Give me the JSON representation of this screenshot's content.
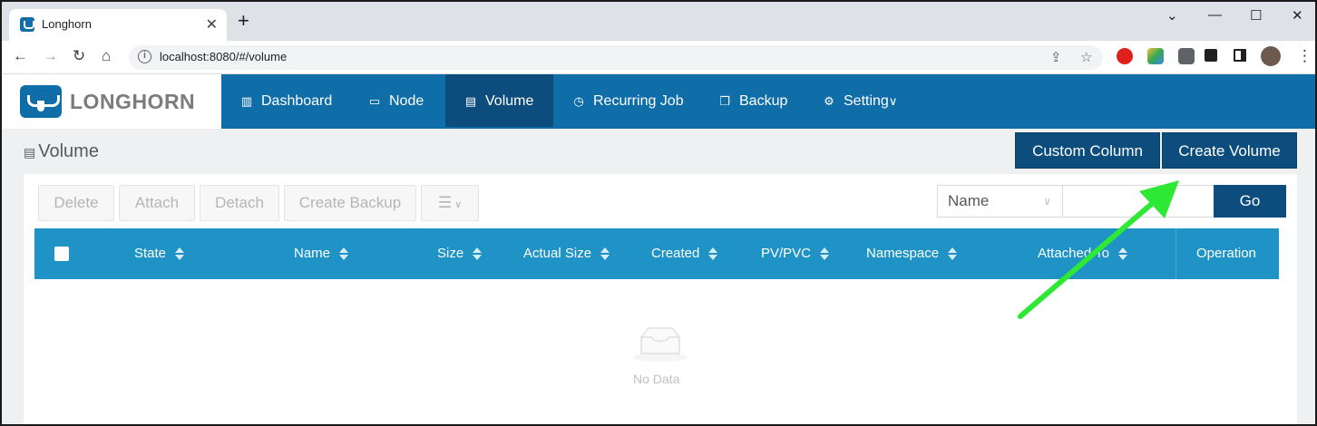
{
  "browser": {
    "tab_title": "Longhorn",
    "tab_close": "✕",
    "new_tab": "+",
    "url": "localhost:8080/#/volume",
    "window_controls": {
      "collapse": "⌄",
      "minimize": "—",
      "maximize": "☐",
      "close": "✕"
    }
  },
  "app": {
    "logo_text": "LONGHORN",
    "brand_color": "#0f6ea8",
    "nav": [
      {
        "label": "Dashboard",
        "icon": "bar-chart-icon"
      },
      {
        "label": "Node",
        "icon": "laptop-icon"
      },
      {
        "label": "Volume",
        "icon": "volume-icon",
        "active": true
      },
      {
        "label": "Recurring Job",
        "icon": "clock-icon"
      },
      {
        "label": "Backup",
        "icon": "copy-icon"
      },
      {
        "label": "Setting",
        "icon": "gear-icon",
        "dropdown": true
      }
    ]
  },
  "page": {
    "title": "Volume",
    "custom_column": "Custom Column",
    "create_volume": "Create Volume"
  },
  "actions": {
    "delete": "Delete",
    "attach": "Attach",
    "detach": "Detach",
    "create_backup": "Create Backup"
  },
  "filter": {
    "field": "Name",
    "search_value": "",
    "go": "Go"
  },
  "table": {
    "columns": [
      "State",
      "Name",
      "Size",
      "Actual Size",
      "Created",
      "PV/PVC",
      "Namespace",
      "Attached To",
      "Operation"
    ],
    "rows": [],
    "empty_text": "No Data"
  }
}
